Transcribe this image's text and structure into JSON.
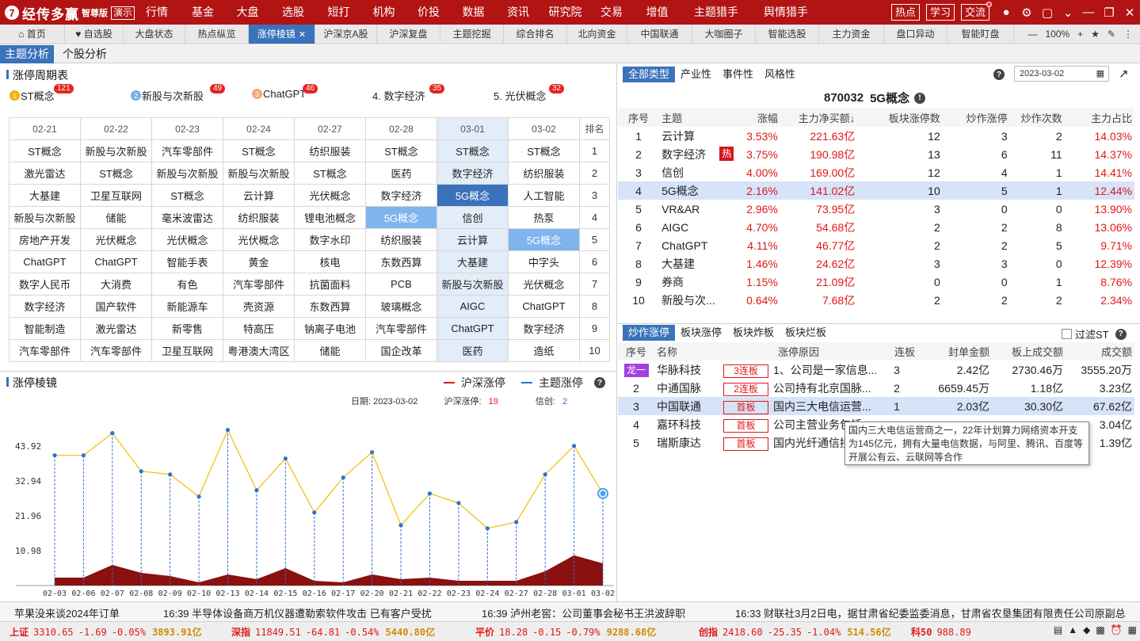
{
  "app": {
    "name": "经传多赢",
    "edition": "智尊版",
    "demo": "演示"
  },
  "menu": [
    "行情",
    "基金",
    "大盘",
    "选股",
    "短打",
    "机构",
    "价投",
    "数据",
    "资讯",
    "研究院",
    "交易",
    "增值",
    "主题猎手",
    "舆情猎手"
  ],
  "topbtns": [
    "热点",
    "学习",
    "交流"
  ],
  "tabs": [
    "首页",
    "自选股",
    "大盘状态",
    "热点纵览",
    "涨停棱镜",
    "沪深京A股",
    "沪深复盘",
    "主题挖掘",
    "综合排名",
    "北向资金",
    "中国联通",
    "大咖圈子",
    "智能选股",
    "主力资金",
    "盘口异动",
    "智能盯盘"
  ],
  "zoom": "100%",
  "subtabs": [
    "主题分析",
    "个股分析"
  ],
  "cycle": {
    "title": "涨停周期表",
    "legend": [
      {
        "rank": "1",
        "name": "ST概念",
        "count": "121"
      },
      {
        "rank": "2",
        "name": "新股与次新股",
        "count": "49"
      },
      {
        "rank": "3",
        "name": "ChatGPT",
        "count": "46"
      },
      {
        "rank": "",
        "name": "4. 数字经济",
        "count": "35"
      },
      {
        "rank": "",
        "name": "5. 光伏概念",
        "count": "32"
      }
    ],
    "dates": [
      "02-21",
      "02-22",
      "02-23",
      "02-24",
      "02-27",
      "02-28",
      "03-01",
      "03-02"
    ],
    "rank_header": "排名",
    "rows": [
      {
        "rank": "1",
        "cells": [
          "ST概念",
          "新股与次新股",
          "汽车零部件",
          "ST概念",
          "纺织服装",
          "ST概念",
          "ST概念",
          "ST概念"
        ]
      },
      {
        "rank": "2",
        "cells": [
          "激光雷达",
          "ST概念",
          "新股与次新股",
          "新股与次新股",
          "ST概念",
          "医药",
          "数字经济",
          "纺织服装"
        ]
      },
      {
        "rank": "3",
        "cells": [
          "大基建",
          "卫星互联网",
          "ST概念",
          "云计算",
          "光伏概念",
          "数字经济",
          "5G概念",
          "人工智能"
        ]
      },
      {
        "rank": "4",
        "cells": [
          "新股与次新股",
          "储能",
          "毫米波雷达",
          "纺织服装",
          "锂电池概念",
          "5G概念",
          "信创",
          "热泵"
        ]
      },
      {
        "rank": "5",
        "cells": [
          "房地产开发",
          "光伏概念",
          "光伏概念",
          "光伏概念",
          "数字水印",
          "纺织服装",
          "云计算",
          "5G概念"
        ]
      },
      {
        "rank": "6",
        "cells": [
          "ChatGPT",
          "ChatGPT",
          "智能手表",
          "黄金",
          "核电",
          "东数西算",
          "大基建",
          "中字头"
        ]
      },
      {
        "rank": "7",
        "cells": [
          "数字人民币",
          "大消费",
          "有色",
          "汽车零部件",
          "抗菌面料",
          "PCB",
          "新股与次新股",
          "光伏概念"
        ]
      },
      {
        "rank": "8",
        "cells": [
          "数字经济",
          "国产软件",
          "新能源车",
          "壳资源",
          "东数西算",
          "玻璃概念",
          "AIGC",
          "ChatGPT"
        ]
      },
      {
        "rank": "9",
        "cells": [
          "智能制造",
          "激光雷达",
          "新零售",
          "特高压",
          "钠离子电池",
          "汽车零部件",
          "ChatGPT",
          "数字经济"
        ]
      },
      {
        "rank": "10",
        "cells": [
          "汽车零部件",
          "汽车零部件",
          "卫星互联网",
          "粤港澳大湾区",
          "储能",
          "国企改革",
          "医药",
          "造纸"
        ]
      }
    ]
  },
  "prism": {
    "title": "涨停棱镜",
    "legend": [
      "沪深涨停",
      "主题涨停"
    ],
    "info_date_label": "日期:",
    "info_date": "2023-03-02",
    "info_hs_label": "沪深涨停:",
    "info_hs": "19",
    "info_theme_label": "信创:",
    "info_theme": "2",
    "yticks": [
      "43.92",
      "32.94",
      "21.96",
      "10.98"
    ],
    "colors": {
      "line": "#f0c000",
      "area": "#8b1010",
      "stem": "#2f6fd6"
    }
  },
  "chart_data": {
    "type": "line",
    "x": [
      "02-03",
      "02-06",
      "02-07",
      "02-08",
      "02-09",
      "02-10",
      "02-13",
      "02-14",
      "02-15",
      "02-16",
      "02-17",
      "02-20",
      "02-21",
      "02-22",
      "02-23",
      "02-24",
      "02-27",
      "02-28",
      "03-01",
      "03-02"
    ],
    "series": [
      {
        "name": "沪深涨停",
        "values": [
          41,
          41,
          48,
          36,
          35,
          28,
          49,
          30,
          40,
          23,
          34,
          42,
          19,
          29,
          26,
          18,
          20,
          35,
          44,
          29
        ]
      },
      {
        "name": "主题涨停",
        "values": [
          2.5,
          2.5,
          6.5,
          4,
          3,
          1,
          3.5,
          2,
          5.5,
          1.5,
          1,
          3.5,
          2,
          2.5,
          1.5,
          1.5,
          1.5,
          4.5,
          9.5,
          7
        ]
      }
    ],
    "ylim": [
      0,
      54.9
    ]
  },
  "right": {
    "typetabs": [
      "全部类型",
      "产业性",
      "事件性",
      "风格性"
    ],
    "date": "2023-03-02",
    "theme_code": "870032",
    "theme_name": "5G概念",
    "headers": [
      "序号",
      "主题",
      "涨幅",
      "主力净买额↓",
      "板块涨停数",
      "炒作涨停",
      "炒作次数",
      "主力占比"
    ],
    "rows": [
      {
        "no": "1",
        "name": "云计算",
        "hot": "",
        "pct": "3.53%",
        "net": "221.63亿",
        "lu": "12",
        "cz": "3",
        "cs": "2",
        "ratio": "14.03%"
      },
      {
        "no": "2",
        "name": "数字经济",
        "hot": "热",
        "pct": "3.75%",
        "net": "190.98亿",
        "lu": "13",
        "cz": "6",
        "cs": "11",
        "ratio": "14.37%"
      },
      {
        "no": "3",
        "name": "信创",
        "hot": "",
        "pct": "4.00%",
        "net": "169.00亿",
        "lu": "12",
        "cz": "4",
        "cs": "1",
        "ratio": "14.41%"
      },
      {
        "no": "4",
        "name": "5G概念",
        "hot": "",
        "pct": "2.16%",
        "net": "141.02亿",
        "lu": "10",
        "cz": "5",
        "cs": "1",
        "ratio": "12.44%"
      },
      {
        "no": "5",
        "name": "VR&AR",
        "hot": "",
        "pct": "2.96%",
        "net": "73.95亿",
        "lu": "3",
        "cz": "0",
        "cs": "0",
        "ratio": "13.90%"
      },
      {
        "no": "6",
        "name": "AIGC",
        "hot": "",
        "pct": "4.70%",
        "net": "54.68亿",
        "lu": "2",
        "cz": "2",
        "cs": "8",
        "ratio": "13.06%"
      },
      {
        "no": "7",
        "name": "ChatGPT",
        "hot": "",
        "pct": "4.11%",
        "net": "46.77亿",
        "lu": "2",
        "cz": "2",
        "cs": "5",
        "ratio": "9.71%"
      },
      {
        "no": "8",
        "name": "大基建",
        "hot": "",
        "pct": "1.46%",
        "net": "24.62亿",
        "lu": "3",
        "cz": "3",
        "cs": "0",
        "ratio": "12.39%"
      },
      {
        "no": "9",
        "name": "券商",
        "hot": "",
        "pct": "1.15%",
        "net": "21.09亿",
        "lu": "0",
        "cz": "0",
        "cs": "1",
        "ratio": "8.76%"
      },
      {
        "no": "10",
        "name": "新股与次...",
        "hot": "",
        "pct": "0.64%",
        "net": "7.68亿",
        "lu": "2",
        "cz": "2",
        "cs": "2",
        "ratio": "2.34%"
      }
    ],
    "stocktabs": [
      "炒作涨停",
      "板块涨停",
      "板块炸板",
      "板块烂板"
    ],
    "filter_label": "过滤ST",
    "stock_headers": [
      "序号",
      "名称",
      "涨停原因",
      "连板",
      "封单金额",
      "板上成交额",
      "成交额"
    ],
    "stocks": [
      {
        "no": "龙一",
        "name": "华脉科技",
        "tag": "3连板",
        "reason": "1、公司是一家信息...",
        "lb": "3",
        "fd": "2.42亿",
        "bs": "2730.46万",
        "cj": "3555.20万"
      },
      {
        "no": "2",
        "name": "中通国脉",
        "tag": "2连板",
        "reason": "公司持有北京国脉...",
        "lb": "2",
        "fd": "6659.45万",
        "bs": "1.18亿",
        "cj": "3.23亿"
      },
      {
        "no": "3",
        "name": "中国联通",
        "tag": "首板",
        "reason": "国内三大电信运营...",
        "lb": "1",
        "fd": "2.03亿",
        "bs": "30.30亿",
        "cj": "67.62亿"
      },
      {
        "no": "4",
        "name": "嘉环科技",
        "tag": "首板",
        "reason": "公司主营业务包括...",
        "lb": "",
        "fd": "",
        "bs": "",
        "cj": "3.04亿"
      },
      {
        "no": "5",
        "name": "瑞斯康达",
        "tag": "首板",
        "reason": "国内光纤通信接...",
        "lb": "",
        "fd": "",
        "bs": "",
        "cj": "1.39亿"
      }
    ],
    "tooltip": "国内三大电信运营商之一，22年计划算力网络资本开支为145亿元，拥有大量电信数据，与阿里、腾讯、百度等开展公有云、云联网等合作"
  },
  "news": [
    "苹果没来谈2024年订单",
    "16:39 半导体设备商万机仪器遭勒索软件攻击 已有客户受扰",
    "16:39 泸州老窖：公司董事会秘书王洪波辞职",
    "16:33 财联社3月2日电，据甘肃省纪委监委消息，甘肃省农垦集团有限责任公司原副总"
  ],
  "indices": [
    {
      "name": "上证",
      "v": "3310.65",
      "c": "-1.69",
      "p": "-0.05%",
      "amt": "3893.91亿"
    },
    {
      "name": "深指",
      "v": "11849.51",
      "c": "-64.81",
      "p": "-0.54%",
      "amt": "5440.80亿"
    },
    {
      "name": "平价",
      "v": "18.28",
      "c": "-0.15",
      "p": "-0.79%",
      "amt": "9288.68亿"
    },
    {
      "name": "创指",
      "v": "2418.60",
      "c": "-25.35",
      "p": "-1.04%",
      "amt": "514.56亿"
    },
    {
      "name": "科50",
      "v": "988.89",
      "c": "",
      "p": "",
      "amt": ""
    }
  ]
}
